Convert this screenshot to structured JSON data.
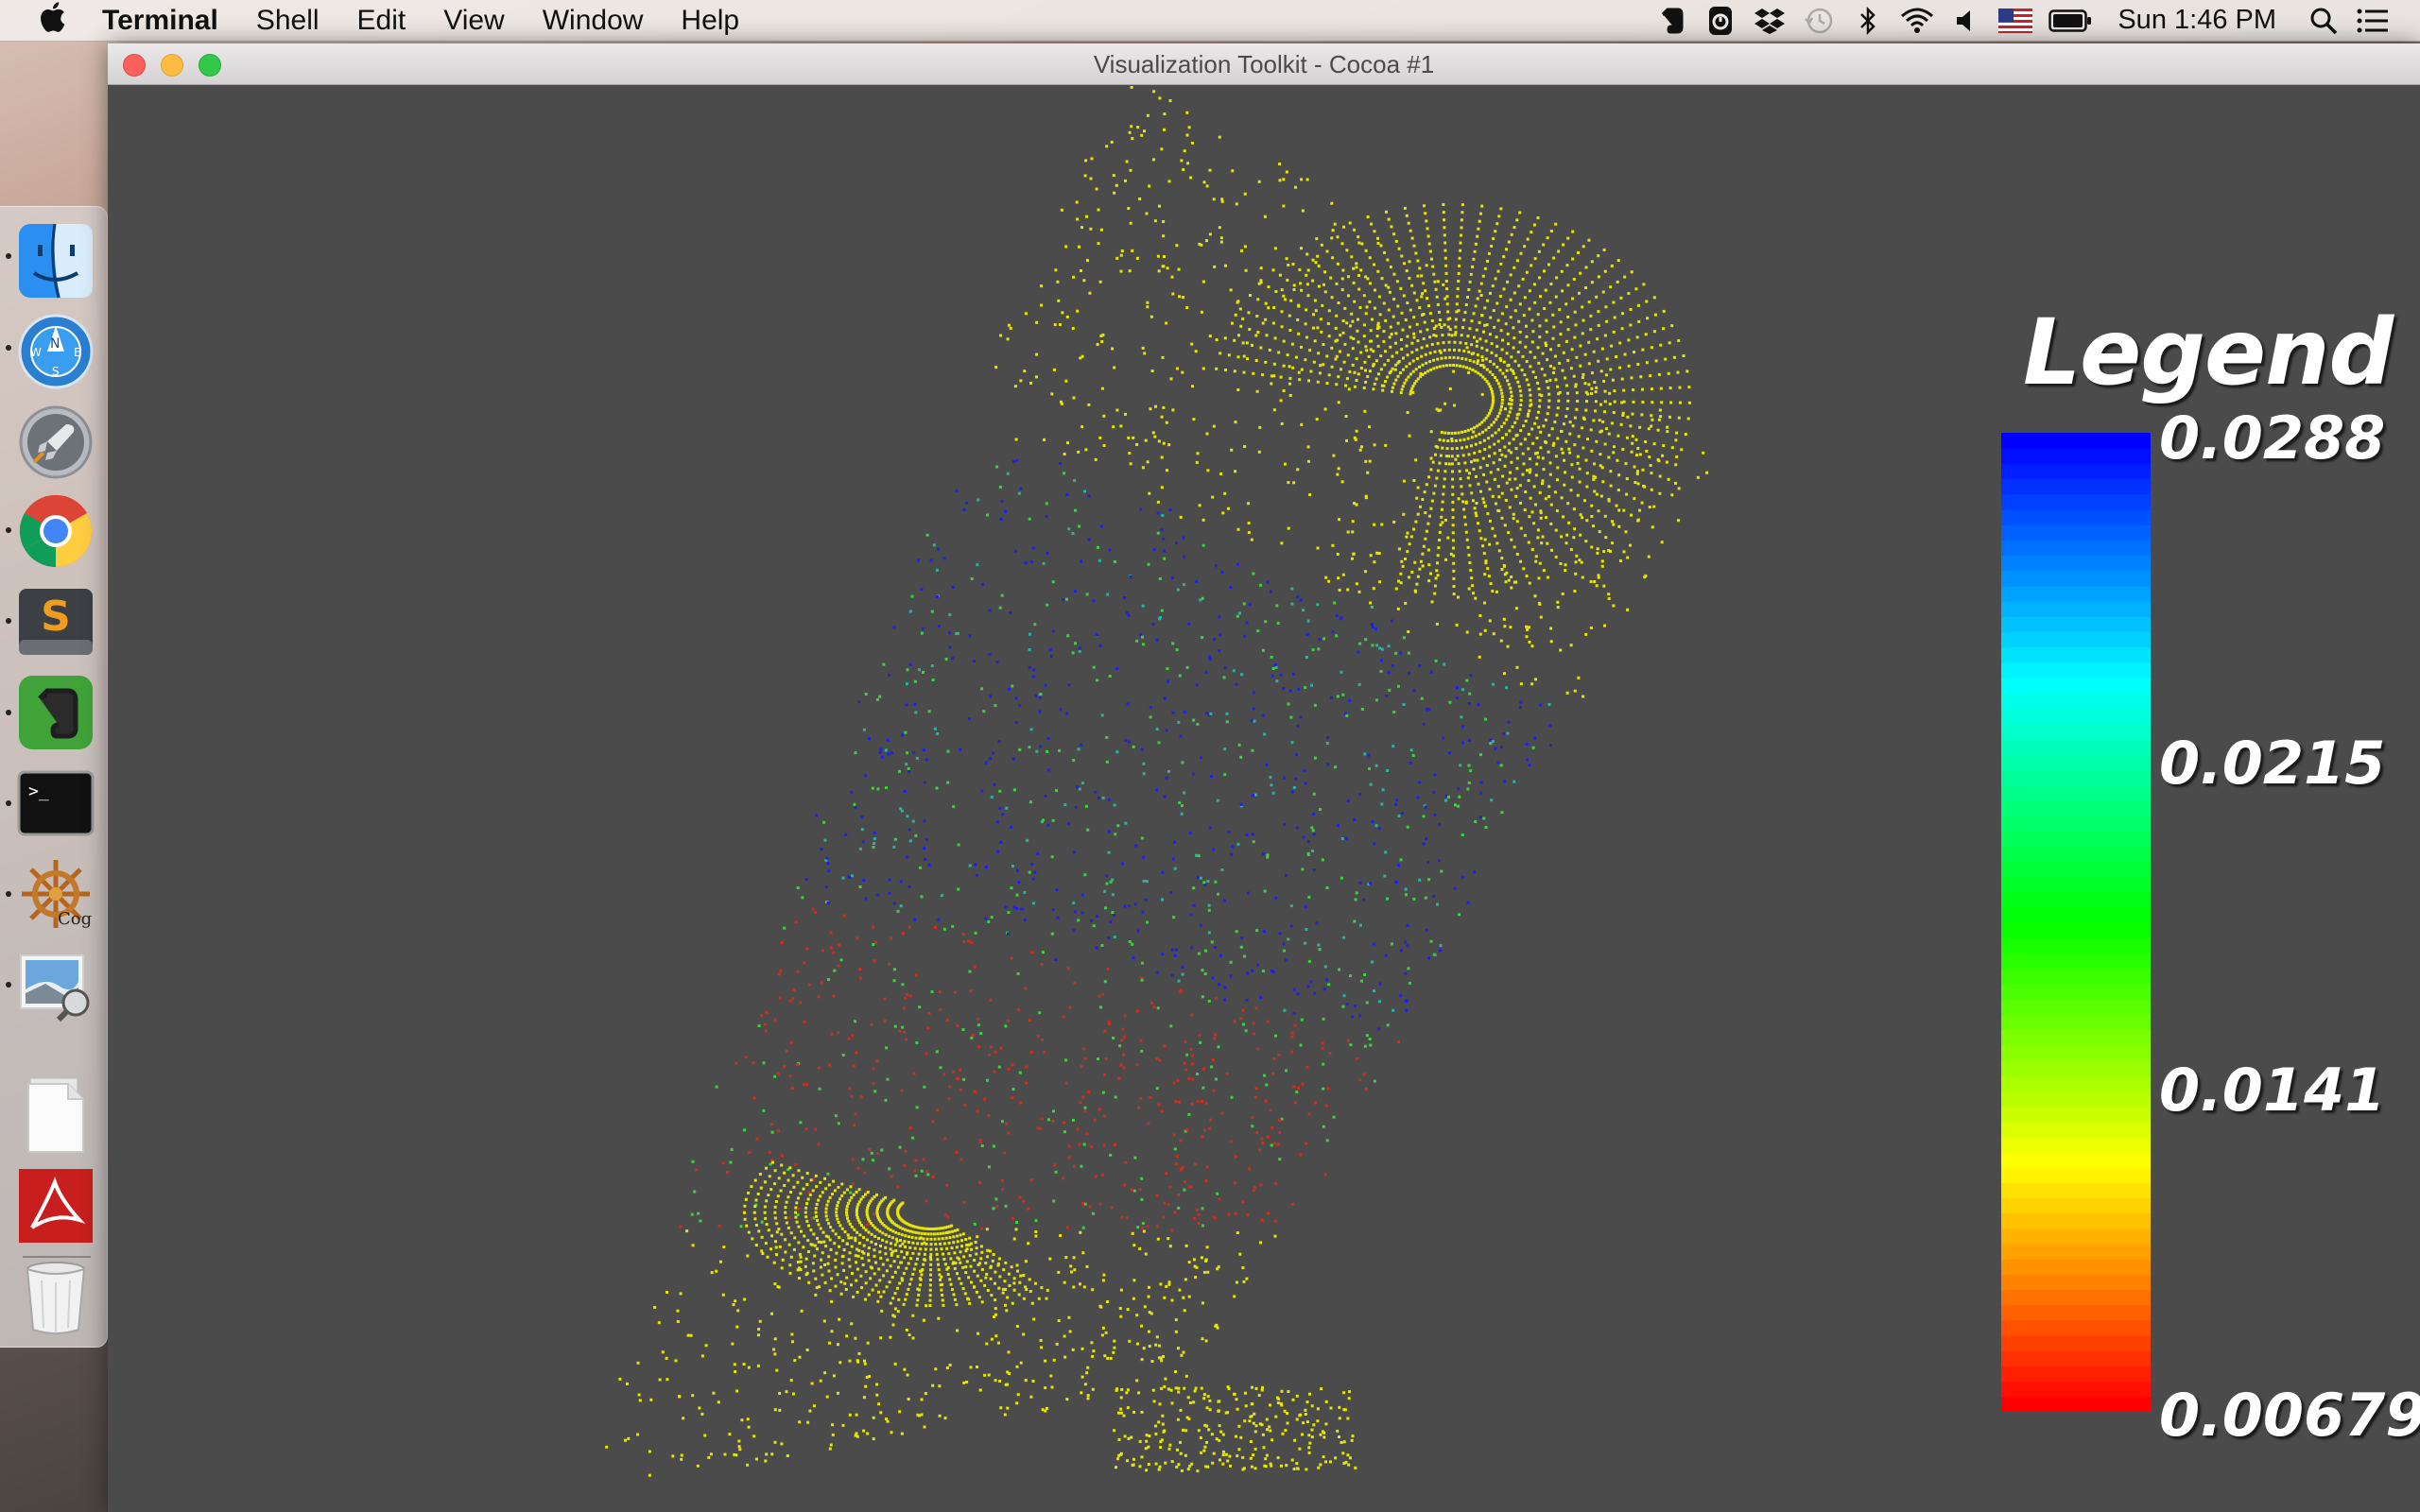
{
  "menubar": {
    "apple_icon": "apple-logo-icon",
    "app_name": "Terminal",
    "items": [
      "Shell",
      "Edit",
      "View",
      "Window",
      "Help"
    ],
    "status_icons": [
      "evernote-icon",
      "timer-icon",
      "dropbox-icon",
      "time-machine-icon",
      "bluetooth-icon",
      "wifi-icon",
      "volume-icon",
      "us-flag-icon",
      "battery-icon"
    ],
    "clock": "Sun 1:46 PM",
    "search_icon": "spotlight-search-icon",
    "notifications_icon": "notification-center-icon"
  },
  "dock": {
    "apps": [
      {
        "name": "finder-icon",
        "running": true
      },
      {
        "name": "network-radar-icon",
        "running": true
      },
      {
        "name": "launchpad-icon",
        "running": false
      },
      {
        "name": "chrome-icon",
        "running": true
      },
      {
        "name": "sublime-text-icon",
        "running": true
      },
      {
        "name": "evernote-icon",
        "running": true
      },
      {
        "name": "terminal-icon",
        "running": true
      },
      {
        "name": "cog-icon",
        "running": true
      },
      {
        "name": "preview-icon",
        "running": true
      }
    ],
    "others": [
      "document-stack-icon",
      "acrobat-icon",
      "trash-icon"
    ],
    "cog_label": "Cog"
  },
  "window": {
    "title": "Visualization Toolkit - Cocoa #1"
  },
  "legend": {
    "title": "Legend",
    "labels": [
      "0.0288",
      "0.0215",
      "0.0141",
      "0.00679"
    ],
    "range": [
      0.00679,
      0.0288
    ],
    "colormap": [
      "#ff0000",
      "#ffff00",
      "#00ff00",
      "#00ffff",
      "#0000ff"
    ]
  },
  "colors": {
    "viewport_bg": "#4b4b4b",
    "point_yellow": "#e6e600",
    "point_green": "#40d040",
    "point_blue": "#2020e0",
    "point_red": "#c83020"
  }
}
